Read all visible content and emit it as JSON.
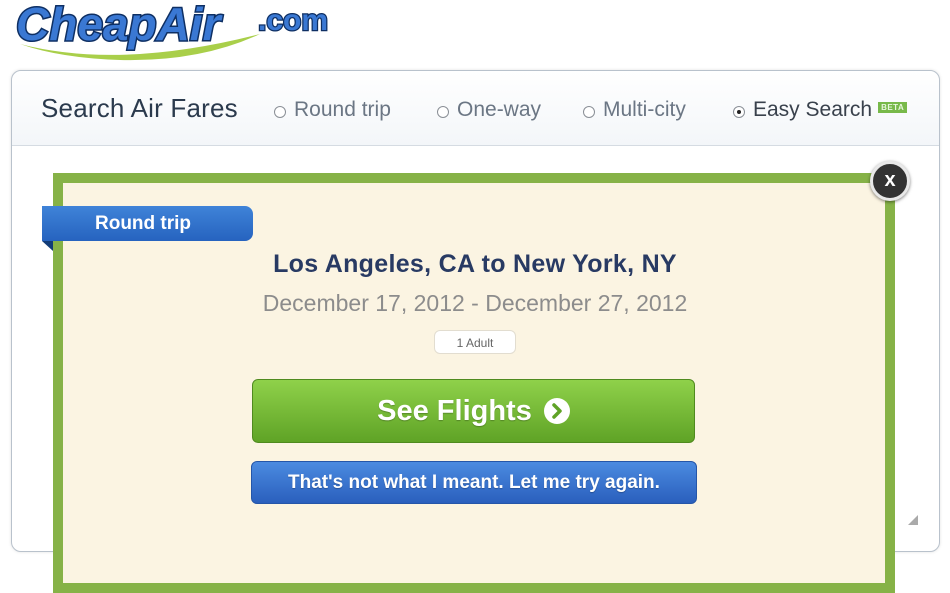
{
  "logo": {
    "text": "CheapAir",
    "suffix": ".com"
  },
  "header": {
    "title": "Search Air Fares",
    "options": [
      {
        "label": "Round trip",
        "checked": false
      },
      {
        "label": "One-way",
        "checked": false
      },
      {
        "label": "Multi-city",
        "checked": false
      },
      {
        "label": "Easy Search",
        "checked": true,
        "badge": "BETA"
      }
    ]
  },
  "result": {
    "trip_type": "Round trip",
    "route": "Los Angeles, CA to New York, NY",
    "dates": "December 17, 2012 - December 27, 2012",
    "passengers": "1 Adult",
    "close_label": "x",
    "see_flights_label": "See Flights",
    "retry_label": "That's not what I meant. Let me try again."
  },
  "colors": {
    "card_border": "#86b247",
    "card_bg": "#fbf4e2",
    "see_flights": "#6fb32f",
    "retry": "#3673cf",
    "ribbon": "#2f6fcc"
  },
  "icons": {
    "arrow": "arrow-right-circle-icon",
    "close": "close-icon"
  }
}
